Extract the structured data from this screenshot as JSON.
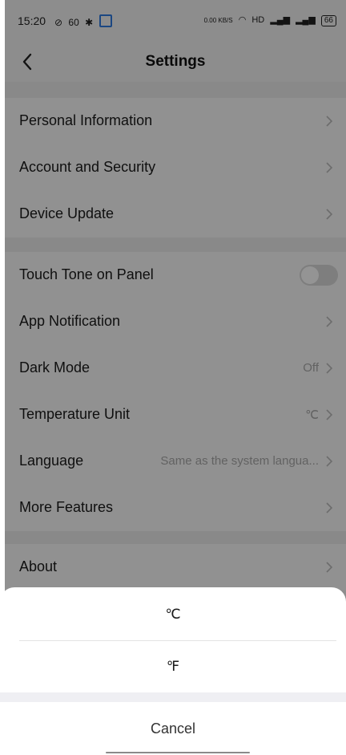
{
  "status_bar": {
    "time": "15:20",
    "left_icons": [
      "no-signal-icon",
      "60hz-icon",
      "fan-icon",
      "clock-icon"
    ],
    "refresh_label": "60",
    "net_speed": "0.00 KB/S",
    "hd_label": "HD",
    "battery": "66"
  },
  "header": {
    "title": "Settings"
  },
  "settings": {
    "group1": [
      {
        "label": "Personal Information"
      },
      {
        "label": "Account and Security"
      },
      {
        "label": "Device Update"
      }
    ],
    "group2": [
      {
        "label": "Touch Tone on Panel",
        "toggle": "off"
      },
      {
        "label": "App Notification"
      },
      {
        "label": "Dark Mode",
        "value": "Off"
      },
      {
        "label": "Temperature Unit",
        "value": "℃"
      },
      {
        "label": "Language",
        "value": "Same as the system langua..."
      },
      {
        "label": "More Features"
      }
    ],
    "group3": [
      {
        "label": "About"
      }
    ]
  },
  "sheet": {
    "options": [
      "℃",
      "℉"
    ],
    "cancel": "Cancel"
  },
  "colors": {
    "overlay": "#000000",
    "toggle_off": "#d9d9d9"
  }
}
